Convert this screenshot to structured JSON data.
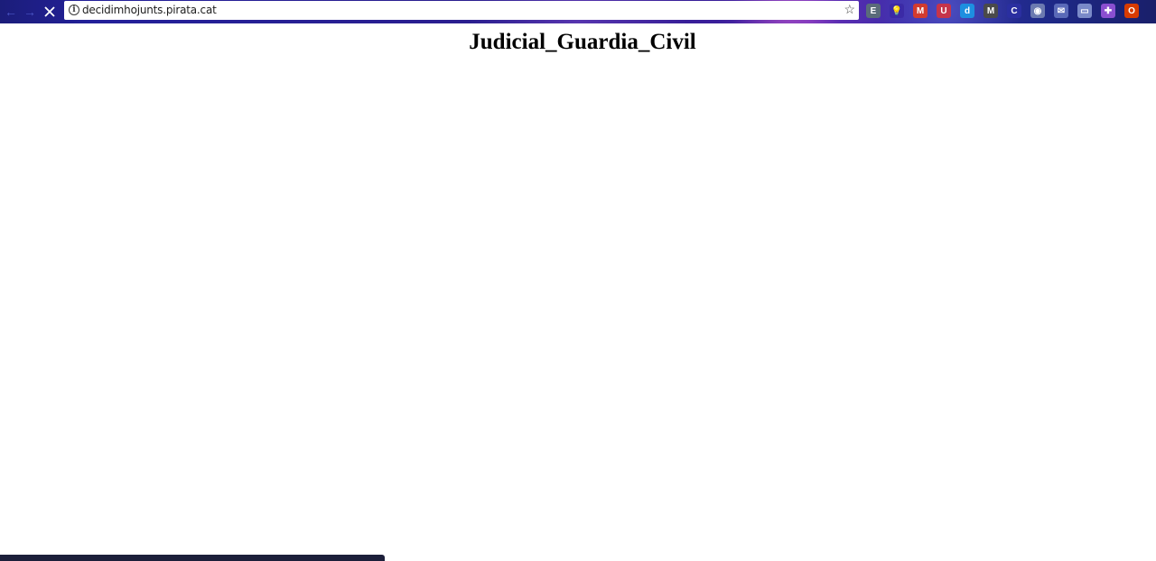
{
  "browser": {
    "url": "decidimhojunts.pirata.cat",
    "nav_icons": [
      "back-arrow-icon",
      "forward-arrow-icon",
      "stop-loading-icon"
    ],
    "info_glyph": "i",
    "star_glyph": "☆",
    "extensions": [
      {
        "name": "evernote-extension-icon",
        "color": "#5a6b7a",
        "glyph": "E"
      },
      {
        "name": "lightbulb-extension-icon",
        "color": "#3b2aa6",
        "glyph": "💡"
      },
      {
        "name": "gmail-extension-icon",
        "color": "#d23b2f",
        "glyph": "M"
      },
      {
        "name": "shield-extension-icon",
        "color": "#c6344a",
        "glyph": "U"
      },
      {
        "name": "d-extension-icon",
        "color": "#1d8fe0",
        "glyph": "d"
      },
      {
        "name": "m-extension-icon",
        "color": "#4a4a4a",
        "glyph": "M"
      },
      {
        "name": "crescent-extension-icon",
        "color": "#2a2fa0",
        "glyph": "C"
      },
      {
        "name": "eye-extension-icon",
        "color": "#6b7ab0",
        "glyph": "◉"
      },
      {
        "name": "mail-extension-icon",
        "color": "#5a6ab8",
        "glyph": "✉"
      },
      {
        "name": "card-extension-icon",
        "color": "#7a8ac8",
        "glyph": "▭"
      },
      {
        "name": "puzzle-extension-icon",
        "color": "#8a4fd0",
        "glyph": "✚"
      },
      {
        "name": "office-extension-icon",
        "color": "#d83b01",
        "glyph": "O"
      }
    ],
    "menu_glyph": "⋮",
    "accent_color": "#23209a"
  },
  "page": {
    "heading": "Judicial_Guardia_Civil"
  }
}
